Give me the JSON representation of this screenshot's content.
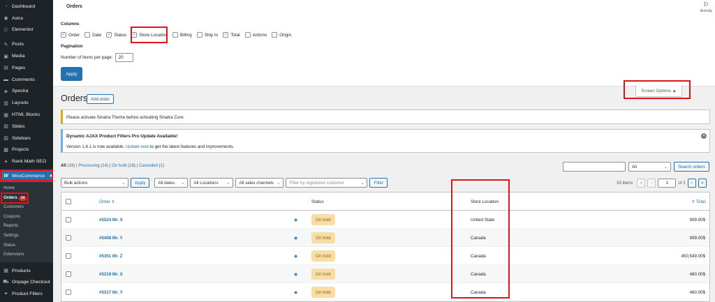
{
  "sidebar": {
    "items_top": [
      {
        "label": "Dashboard",
        "icon": "dashboard-icon",
        "glyph": "◔"
      },
      {
        "label": "Astra",
        "icon": "astra-icon",
        "glyph": "◉"
      },
      {
        "label": "Elementor",
        "icon": "elementor-icon",
        "glyph": "ⓔ"
      }
    ],
    "items_mid": [
      {
        "label": "Posts",
        "icon": "pin-icon",
        "glyph": "✎"
      },
      {
        "label": "Media",
        "icon": "media-icon",
        "glyph": "▣"
      },
      {
        "label": "Pages",
        "icon": "pages-icon",
        "glyph": "▤"
      },
      {
        "label": "Comments",
        "icon": "comments-icon",
        "glyph": "▬"
      },
      {
        "label": "Spectra",
        "icon": "spectra-icon",
        "glyph": "◈"
      },
      {
        "label": "Layouts",
        "icon": "layouts-icon",
        "glyph": "▥"
      },
      {
        "label": "HTML Blocks",
        "icon": "html-blocks-icon",
        "glyph": "▦"
      },
      {
        "label": "Slides",
        "icon": "slides-icon",
        "glyph": "▧"
      },
      {
        "label": "Sidebars",
        "icon": "sidebars-icon",
        "glyph": "▨"
      },
      {
        "label": "Projects",
        "icon": "projects-icon",
        "glyph": "▩"
      },
      {
        "label": "Rank Math SEO",
        "icon": "rank-math-icon",
        "glyph": "✦"
      }
    ],
    "woocommerce": {
      "label": "WooCommerce",
      "glyph": "W"
    },
    "submenu": [
      {
        "label": "Home"
      },
      {
        "label": "Orders",
        "badge": "14"
      },
      {
        "label": "Customers"
      },
      {
        "label": "Coupons"
      },
      {
        "label": "Reports"
      },
      {
        "label": "Settings"
      },
      {
        "label": "Status"
      },
      {
        "label": "Extensions"
      }
    ],
    "items_bottom": [
      {
        "label": "Products",
        "icon": "products-icon",
        "glyph": "▦"
      },
      {
        "label": "Onpage Checkout",
        "icon": "checkout-icon",
        "glyph": "⛟"
      },
      {
        "label": "Product Filters",
        "icon": "filter-icon",
        "glyph": "⏷"
      }
    ]
  },
  "screen_options": {
    "title": "Orders",
    "activity_label": "Activity",
    "columns_heading": "Columns",
    "columns": [
      {
        "label": "Order",
        "checked": true
      },
      {
        "label": "Date",
        "checked": false
      },
      {
        "label": "Status",
        "checked": true
      },
      {
        "label": "Store Location",
        "checked": true
      },
      {
        "label": "Billing",
        "checked": false
      },
      {
        "label": "Ship to",
        "checked": false
      },
      {
        "label": "Total",
        "checked": true
      },
      {
        "label": "Actions",
        "checked": false
      },
      {
        "label": "Origin",
        "checked": false
      }
    ],
    "pagination_heading": "Pagination",
    "items_per_page_label": "Number of items per page:",
    "items_per_page_value": "20",
    "apply_label": "Apply",
    "toggle_label": "Screen Options ▲"
  },
  "main": {
    "title": "Orders",
    "add_order_label": "Add order",
    "notice_sinatra": "Please activate Sinatra Theme before activating Sinatra Core.",
    "notice_ajax": {
      "title": "Dynamic AJAX Product Filters Pro Update Available!",
      "prefix": "Version 1.6.1 is now available. ",
      "link": "Update now",
      "suffix": " to get the latest features and improvements."
    },
    "views": [
      {
        "label": "All",
        "count": " (33)",
        "current": true
      },
      {
        "label": "Processing",
        "count": " (14)"
      },
      {
        "label": "On hold",
        "count": " (18)"
      },
      {
        "label": "Cancelled",
        "count": " (1)"
      }
    ],
    "search": {
      "scope": "All",
      "button": "Search orders"
    },
    "filters": {
      "bulk_actions": "Bulk actions",
      "apply": "Apply",
      "dates": "All dates",
      "locations": "All Locations",
      "channels": "All sales channels",
      "customer_placeholder": "Filter by registered customer",
      "filter_button": "Filter"
    },
    "pagination": {
      "items": "33 items",
      "first": "«",
      "prev": "‹",
      "current": "1",
      "of": "of 2",
      "next": "›",
      "last": "»"
    },
    "table": {
      "headers": {
        "order": "Order ⇕",
        "status": "Status",
        "location": "Store Location",
        "total": "⇕ Total"
      },
      "rows": [
        {
          "order": "#5524 Mr. X",
          "status": "On hold",
          "location": "United State",
          "total": "999.00$"
        },
        {
          "order": "#5408 Mr. Y",
          "status": "On hold",
          "location": "Canada",
          "total": "999.00$"
        },
        {
          "order": "#5351 Mr. Z",
          "status": "On hold",
          "location": "Canada",
          "total": "450,549.00$"
        },
        {
          "order": "#5319 Mr. X",
          "status": "On hold",
          "location": "Canada",
          "total": "460.00$"
        },
        {
          "order": "#5317 Mr. Y",
          "status": "On hold",
          "location": "Canada",
          "total": "460.00$"
        }
      ]
    }
  },
  "colors": {
    "accent": "#2271b1",
    "sidebar": "#1d2327",
    "highlight": "#e0141b",
    "onhold_bg": "#f8dda7"
  }
}
